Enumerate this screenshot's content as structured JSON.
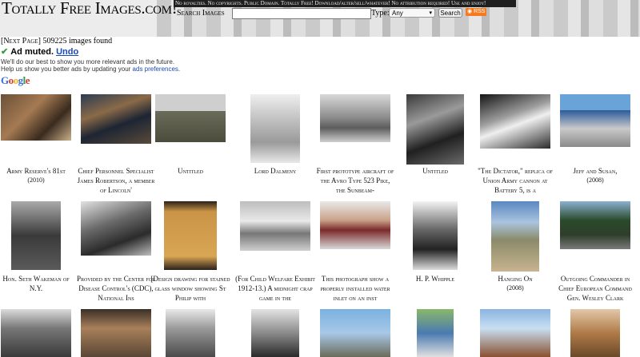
{
  "header": {
    "site_title": "Totally Free Images.com!",
    "tagline": "No royalties. No copyrights. Public Domain. Totally Free! Download/alter/sell/whatever! No attribution required! Use and enjoy!",
    "search_label": "Search Images",
    "search_value": "",
    "type_label": "Type:",
    "type_value": "Any",
    "search_button": "Search",
    "rss_label": "RSS"
  },
  "results": {
    "next_page": "[Next Page]",
    "count_text": "509225 images found"
  },
  "ad": {
    "muted": "Ad muted.",
    "undo": "Undo",
    "line1": "We'll do our best to show you more relevant ads in the future.",
    "line2_prefix": "Help us show you better ads by updating your ",
    "line2_link": "ads preferences",
    "line2_suffix": ".",
    "brand": "Google"
  },
  "grid": [
    {
      "caption": "Army Reserve's 81st",
      "date": "(2010)"
    },
    {
      "caption": "Chief Personnel Specialist James Robertson, a member of Lincoln'",
      "date": ""
    },
    {
      "caption": "Untitled",
      "date": ""
    },
    {
      "caption": "Lord Dalmeny",
      "date": ""
    },
    {
      "caption": "First prototype aircraft of the Avro Type 523 Pike, the Sunbeam-",
      "date": ""
    },
    {
      "caption": "Untitled",
      "date": ""
    },
    {
      "caption": "\"The Dictator,\" replica of Union Army cannon at Battery 5, is a",
      "date": ""
    },
    {
      "caption": "Jeff and Susan,",
      "date": "(2008)"
    },
    {
      "caption": "Hon. Seth Wakeman of N.Y.",
      "date": ""
    },
    {
      "caption": "Provided by the Center for Disease Control's (CDC), National Ins",
      "date": ""
    },
    {
      "caption": "[Design drawing for stained glass window showing St Philip with",
      "date": ""
    },
    {
      "caption": "(For Child Welfare Exhibit 1912-13.) A midnight crap game in the",
      "date": ""
    },
    {
      "caption": "This photograph show a properly installed water inlet on an inst",
      "date": ""
    },
    {
      "caption": "H. P. Whipple",
      "date": ""
    },
    {
      "caption": "Hanging On",
      "date": "(2008)"
    },
    {
      "caption": "Outgoing Commander in Chief European Command Gen. Wesley Clark",
      "date": ""
    }
  ],
  "colors": {
    "link": "#1a49b5",
    "check": "#3a9a3a",
    "rss": "#f47a1f"
  }
}
